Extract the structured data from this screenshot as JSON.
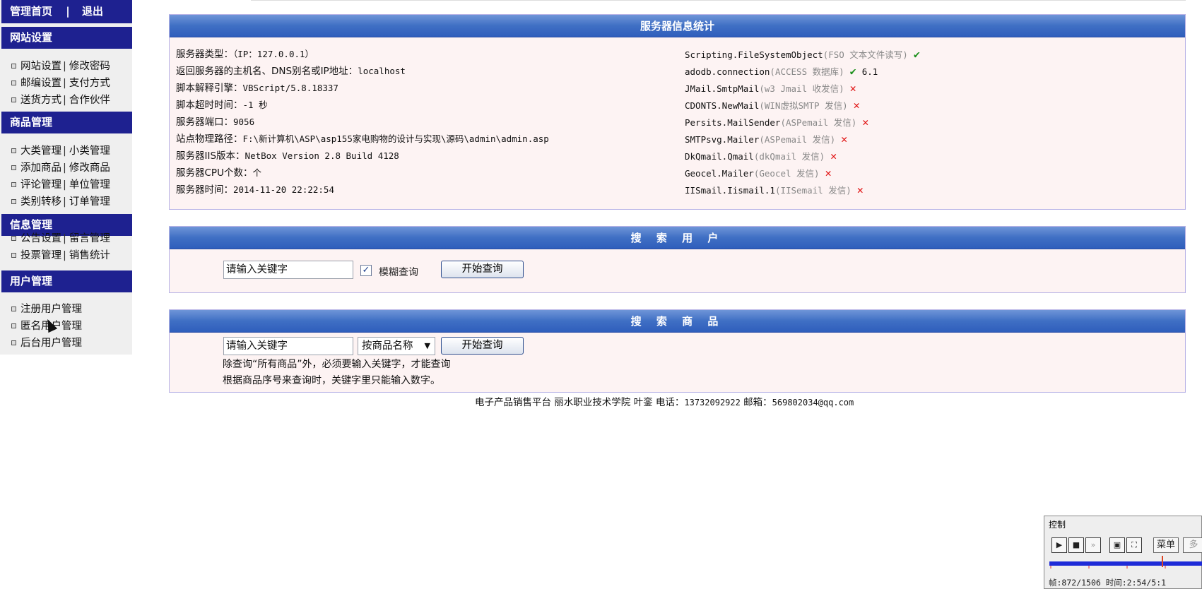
{
  "sidebar": {
    "top": {
      "home": "管理首页",
      "sep": "|",
      "logout": "退出"
    },
    "sections": [
      {
        "title": "网站设置",
        "rows": [
          [
            "网站设置",
            "修改密码"
          ],
          [
            "邮编设置",
            "支付方式"
          ],
          [
            "送货方式",
            "合作伙伴"
          ]
        ]
      },
      {
        "title": "商品管理",
        "rows": [
          [
            "大类管理",
            "小类管理"
          ],
          [
            "添加商品",
            "修改商品"
          ],
          [
            "评论管理",
            "单位管理"
          ],
          [
            "类别转移",
            "订单管理"
          ]
        ]
      },
      {
        "title": "信息管理",
        "rows": [
          [
            "公告设置",
            "留言管理"
          ],
          [
            "投票管理",
            "销售统计"
          ]
        ]
      },
      {
        "title": "用户管理",
        "rows": [
          [
            "注册用户管理"
          ],
          [
            "匿名用户管理"
          ],
          [
            "后台用户管理"
          ]
        ]
      }
    ]
  },
  "server_info": {
    "title": "服务器信息统计",
    "left": [
      {
        "label": "服务器类型：",
        "value": "（IP：127.0.0.1）"
      },
      {
        "label": "返回服务器的主机名、DNS别名或IP地址：",
        "value": "localhost"
      },
      {
        "label": "脚本解释引擎：",
        "value": "VBScript/5.8.18337"
      },
      {
        "label": "脚本超时时间：",
        "value": "-1 秒"
      },
      {
        "label": "服务器端口：",
        "value": "9056"
      },
      {
        "label": "站点物理路径：",
        "value": "F:\\新计算机\\ASP\\asp155家电购物的设计与实现\\源码\\admin\\admin.asp"
      },
      {
        "label": "服务器IIS版本：",
        "value": "NetBox Version 2.8 Build 4128"
      },
      {
        "label": "服务器CPU个数：",
        "value": "个"
      },
      {
        "label": "服务器时间：",
        "value": "2014-11-20 22:22:54"
      }
    ],
    "right": [
      {
        "name": "Scripting.FileSystemObject",
        "desc": "(FSO 文本文件读写)",
        "status": "✔",
        "ok": true,
        "extra": ""
      },
      {
        "name": "adodb.connection",
        "desc": "(ACCESS 数据库)",
        "status": "✔",
        "ok": true,
        "extra": "6.1"
      },
      {
        "name": "JMail.SmtpMail",
        "desc": "(w3 Jmail 收发信)",
        "status": "✕",
        "ok": false,
        "extra": ""
      },
      {
        "name": "CDONTS.NewMail",
        "desc": "(WIN虚拟SMTP 发信)",
        "status": "✕",
        "ok": false,
        "extra": ""
      },
      {
        "name": "Persits.MailSender",
        "desc": "(ASPemail 发信)",
        "status": "✕",
        "ok": false,
        "extra": ""
      },
      {
        "name": "SMTPsvg.Mailer",
        "desc": "(ASPemail 发信)",
        "status": "✕",
        "ok": false,
        "extra": ""
      },
      {
        "name": "DkQmail.Qmail",
        "desc": "(dkQmail 发信)",
        "status": "✕",
        "ok": false,
        "extra": ""
      },
      {
        "name": "Geocel.Mailer",
        "desc": "(Geocel 发信)",
        "status": "✕",
        "ok": false,
        "extra": ""
      },
      {
        "name": "IISmail.Iismail.1",
        "desc": "(IISemail 发信)",
        "status": "✕",
        "ok": false,
        "extra": ""
      }
    ]
  },
  "search_user": {
    "title": "搜 索 用 户",
    "keyword_value": "请输入关键字",
    "fuzzy_label": "模糊查询",
    "fuzzy_checked": "✓",
    "button": "开始查询"
  },
  "search_goods": {
    "title": "搜 索 商 品",
    "keyword_value": "请输入关键字",
    "select_value": "按商品名称",
    "button": "开始查询",
    "note1": "除查询“所有商品”外，必须要输入关键字，才能查询",
    "note2": "根据商品序号来查询时，关键字里只能输入数字。"
  },
  "footer": {
    "text": "电子产品销售平台 丽水职业技术学院 叶銮 电话：",
    "phone": "13732092922",
    "mail_label": " 邮箱：",
    "mail": "569802034@qq.com"
  },
  "control": {
    "title": "控制",
    "menu": "菜单",
    "more": "多",
    "status": "帧:872/1506 时间:2:54/5:1"
  }
}
